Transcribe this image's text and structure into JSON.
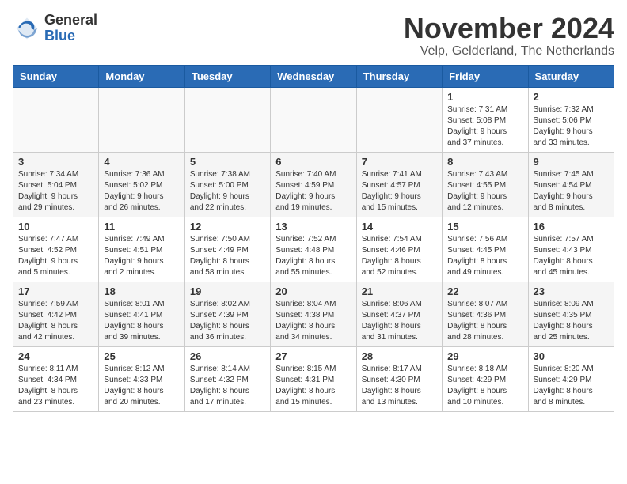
{
  "logo": {
    "general": "General",
    "blue": "Blue"
  },
  "title": "November 2024",
  "location": "Velp, Gelderland, The Netherlands",
  "days_of_week": [
    "Sunday",
    "Monday",
    "Tuesday",
    "Wednesday",
    "Thursday",
    "Friday",
    "Saturday"
  ],
  "weeks": [
    {
      "shaded": false,
      "days": [
        {
          "number": "",
          "info": ""
        },
        {
          "number": "",
          "info": ""
        },
        {
          "number": "",
          "info": ""
        },
        {
          "number": "",
          "info": ""
        },
        {
          "number": "",
          "info": ""
        },
        {
          "number": "1",
          "info": "Sunrise: 7:31 AM\nSunset: 5:08 PM\nDaylight: 9 hours\nand 37 minutes."
        },
        {
          "number": "2",
          "info": "Sunrise: 7:32 AM\nSunset: 5:06 PM\nDaylight: 9 hours\nand 33 minutes."
        }
      ]
    },
    {
      "shaded": true,
      "days": [
        {
          "number": "3",
          "info": "Sunrise: 7:34 AM\nSunset: 5:04 PM\nDaylight: 9 hours\nand 29 minutes."
        },
        {
          "number": "4",
          "info": "Sunrise: 7:36 AM\nSunset: 5:02 PM\nDaylight: 9 hours\nand 26 minutes."
        },
        {
          "number": "5",
          "info": "Sunrise: 7:38 AM\nSunset: 5:00 PM\nDaylight: 9 hours\nand 22 minutes."
        },
        {
          "number": "6",
          "info": "Sunrise: 7:40 AM\nSunset: 4:59 PM\nDaylight: 9 hours\nand 19 minutes."
        },
        {
          "number": "7",
          "info": "Sunrise: 7:41 AM\nSunset: 4:57 PM\nDaylight: 9 hours\nand 15 minutes."
        },
        {
          "number": "8",
          "info": "Sunrise: 7:43 AM\nSunset: 4:55 PM\nDaylight: 9 hours\nand 12 minutes."
        },
        {
          "number": "9",
          "info": "Sunrise: 7:45 AM\nSunset: 4:54 PM\nDaylight: 9 hours\nand 8 minutes."
        }
      ]
    },
    {
      "shaded": false,
      "days": [
        {
          "number": "10",
          "info": "Sunrise: 7:47 AM\nSunset: 4:52 PM\nDaylight: 9 hours\nand 5 minutes."
        },
        {
          "number": "11",
          "info": "Sunrise: 7:49 AM\nSunset: 4:51 PM\nDaylight: 9 hours\nand 2 minutes."
        },
        {
          "number": "12",
          "info": "Sunrise: 7:50 AM\nSunset: 4:49 PM\nDaylight: 8 hours\nand 58 minutes."
        },
        {
          "number": "13",
          "info": "Sunrise: 7:52 AM\nSunset: 4:48 PM\nDaylight: 8 hours\nand 55 minutes."
        },
        {
          "number": "14",
          "info": "Sunrise: 7:54 AM\nSunset: 4:46 PM\nDaylight: 8 hours\nand 52 minutes."
        },
        {
          "number": "15",
          "info": "Sunrise: 7:56 AM\nSunset: 4:45 PM\nDaylight: 8 hours\nand 49 minutes."
        },
        {
          "number": "16",
          "info": "Sunrise: 7:57 AM\nSunset: 4:43 PM\nDaylight: 8 hours\nand 45 minutes."
        }
      ]
    },
    {
      "shaded": true,
      "days": [
        {
          "number": "17",
          "info": "Sunrise: 7:59 AM\nSunset: 4:42 PM\nDaylight: 8 hours\nand 42 minutes."
        },
        {
          "number": "18",
          "info": "Sunrise: 8:01 AM\nSunset: 4:41 PM\nDaylight: 8 hours\nand 39 minutes."
        },
        {
          "number": "19",
          "info": "Sunrise: 8:02 AM\nSunset: 4:39 PM\nDaylight: 8 hours\nand 36 minutes."
        },
        {
          "number": "20",
          "info": "Sunrise: 8:04 AM\nSunset: 4:38 PM\nDaylight: 8 hours\nand 34 minutes."
        },
        {
          "number": "21",
          "info": "Sunrise: 8:06 AM\nSunset: 4:37 PM\nDaylight: 8 hours\nand 31 minutes."
        },
        {
          "number": "22",
          "info": "Sunrise: 8:07 AM\nSunset: 4:36 PM\nDaylight: 8 hours\nand 28 minutes."
        },
        {
          "number": "23",
          "info": "Sunrise: 8:09 AM\nSunset: 4:35 PM\nDaylight: 8 hours\nand 25 minutes."
        }
      ]
    },
    {
      "shaded": false,
      "days": [
        {
          "number": "24",
          "info": "Sunrise: 8:11 AM\nSunset: 4:34 PM\nDaylight: 8 hours\nand 23 minutes."
        },
        {
          "number": "25",
          "info": "Sunrise: 8:12 AM\nSunset: 4:33 PM\nDaylight: 8 hours\nand 20 minutes."
        },
        {
          "number": "26",
          "info": "Sunrise: 8:14 AM\nSunset: 4:32 PM\nDaylight: 8 hours\nand 17 minutes."
        },
        {
          "number": "27",
          "info": "Sunrise: 8:15 AM\nSunset: 4:31 PM\nDaylight: 8 hours\nand 15 minutes."
        },
        {
          "number": "28",
          "info": "Sunrise: 8:17 AM\nSunset: 4:30 PM\nDaylight: 8 hours\nand 13 minutes."
        },
        {
          "number": "29",
          "info": "Sunrise: 8:18 AM\nSunset: 4:29 PM\nDaylight: 8 hours\nand 10 minutes."
        },
        {
          "number": "30",
          "info": "Sunrise: 8:20 AM\nSunset: 4:29 PM\nDaylight: 8 hours\nand 8 minutes."
        }
      ]
    }
  ]
}
